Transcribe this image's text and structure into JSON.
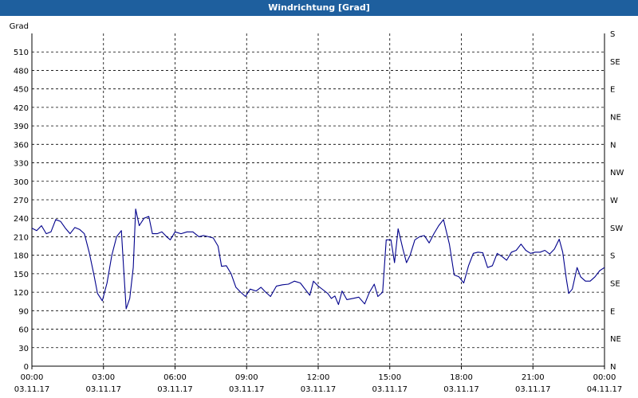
{
  "window": {
    "title": "Windrichtung [Grad]",
    "title_bar_color": "#1e5f9e"
  },
  "chart_data": {
    "type": "line",
    "title": "Windrichtung [Grad]",
    "ylabel": "Grad",
    "xlabel": "",
    "ylim": [
      0,
      540
    ],
    "y_ticks": [
      0,
      30,
      60,
      90,
      120,
      150,
      180,
      210,
      240,
      270,
      300,
      330,
      360,
      390,
      420,
      450,
      480,
      510
    ],
    "right_axis_labels": [
      {
        "value": 0,
        "label": "N"
      },
      {
        "value": 45,
        "label": "NE"
      },
      {
        "value": 90,
        "label": "E"
      },
      {
        "value": 135,
        "label": "SE"
      },
      {
        "value": 180,
        "label": "S"
      },
      {
        "value": 225,
        "label": "SW"
      },
      {
        "value": 270,
        "label": "W"
      },
      {
        "value": 315,
        "label": "NW"
      },
      {
        "value": 360,
        "label": "N"
      },
      {
        "value": 405,
        "label": "NE"
      },
      {
        "value": 450,
        "label": "E"
      },
      {
        "value": 495,
        "label": "SE"
      },
      {
        "value": 540,
        "label": "S"
      }
    ],
    "x_range_hours": [
      0,
      24
    ],
    "x_ticks": [
      {
        "hour": 0,
        "time": "00:00",
        "date": "03.11.17"
      },
      {
        "hour": 3,
        "time": "03:00",
        "date": "03.11.17"
      },
      {
        "hour": 6,
        "time": "06:00",
        "date": "03.11.17"
      },
      {
        "hour": 9,
        "time": "09:00",
        "date": "03.11.17"
      },
      {
        "hour": 12,
        "time": "12:00",
        "date": "03.11.17"
      },
      {
        "hour": 15,
        "time": "15:00",
        "date": "03.11.17"
      },
      {
        "hour": 18,
        "time": "18:00",
        "date": "03.11.17"
      },
      {
        "hour": 21,
        "time": "21:00",
        "date": "03.11.17"
      },
      {
        "hour": 24,
        "time": "00:00",
        "date": "04.11.17"
      }
    ],
    "grid": true,
    "line_color": "#00008b",
    "series": [
      {
        "points": [
          [
            0.0,
            224
          ],
          [
            0.2,
            220
          ],
          [
            0.4,
            228
          ],
          [
            0.6,
            215
          ],
          [
            0.8,
            218
          ],
          [
            1.0,
            238
          ],
          [
            1.2,
            235
          ],
          [
            1.4,
            224
          ],
          [
            1.6,
            215
          ],
          [
            1.8,
            225
          ],
          [
            2.0,
            222
          ],
          [
            2.2,
            215
          ],
          [
            2.4,
            185
          ],
          [
            2.6,
            148
          ],
          [
            2.75,
            118
          ],
          [
            2.95,
            106
          ],
          [
            3.15,
            135
          ],
          [
            3.35,
            180
          ],
          [
            3.55,
            210
          ],
          [
            3.75,
            220
          ],
          [
            3.85,
            155
          ],
          [
            3.95,
            93
          ],
          [
            4.1,
            110
          ],
          [
            4.25,
            160
          ],
          [
            4.35,
            255
          ],
          [
            4.5,
            228
          ],
          [
            4.7,
            240
          ],
          [
            4.9,
            243
          ],
          [
            5.05,
            215
          ],
          [
            5.25,
            215
          ],
          [
            5.45,
            218
          ],
          [
            5.65,
            210
          ],
          [
            5.8,
            205
          ],
          [
            6.0,
            218
          ],
          [
            6.25,
            215
          ],
          [
            6.5,
            218
          ],
          [
            6.75,
            218
          ],
          [
            7.0,
            210
          ],
          [
            7.2,
            212
          ],
          [
            7.4,
            210
          ],
          [
            7.6,
            208
          ],
          [
            7.8,
            195
          ],
          [
            7.95,
            162
          ],
          [
            8.15,
            163
          ],
          [
            8.35,
            150
          ],
          [
            8.55,
            128
          ],
          [
            8.75,
            120
          ],
          [
            8.95,
            113
          ],
          [
            9.15,
            125
          ],
          [
            9.4,
            122
          ],
          [
            9.6,
            128
          ],
          [
            9.8,
            120
          ],
          [
            10.0,
            113
          ],
          [
            10.25,
            130
          ],
          [
            10.5,
            132
          ],
          [
            10.75,
            133
          ],
          [
            11.0,
            138
          ],
          [
            11.25,
            135
          ],
          [
            11.45,
            125
          ],
          [
            11.65,
            115
          ],
          [
            11.8,
            138
          ],
          [
            12.0,
            130
          ],
          [
            12.2,
            124
          ],
          [
            12.4,
            118
          ],
          [
            12.55,
            110
          ],
          [
            12.7,
            114
          ],
          [
            12.85,
            100
          ],
          [
            13.0,
            122
          ],
          [
            13.2,
            108
          ],
          [
            13.45,
            110
          ],
          [
            13.7,
            112
          ],
          [
            13.95,
            101
          ],
          [
            14.15,
            120
          ],
          [
            14.35,
            133
          ],
          [
            14.5,
            113
          ],
          [
            14.7,
            120
          ],
          [
            14.85,
            205
          ],
          [
            15.05,
            205
          ],
          [
            15.2,
            168
          ],
          [
            15.35,
            223
          ],
          [
            15.55,
            190
          ],
          [
            15.7,
            168
          ],
          [
            15.85,
            180
          ],
          [
            16.05,
            205
          ],
          [
            16.25,
            210
          ],
          [
            16.45,
            212
          ],
          [
            16.65,
            200
          ],
          [
            16.85,
            215
          ],
          [
            17.05,
            228
          ],
          [
            17.25,
            238
          ],
          [
            17.5,
            198
          ],
          [
            17.7,
            148
          ],
          [
            17.9,
            145
          ],
          [
            18.1,
            135
          ],
          [
            18.3,
            163
          ],
          [
            18.5,
            183
          ],
          [
            18.7,
            185
          ],
          [
            18.9,
            184
          ],
          [
            19.1,
            160
          ],
          [
            19.3,
            163
          ],
          [
            19.5,
            183
          ],
          [
            19.7,
            178
          ],
          [
            19.9,
            172
          ],
          [
            20.1,
            185
          ],
          [
            20.3,
            188
          ],
          [
            20.5,
            198
          ],
          [
            20.7,
            188
          ],
          [
            20.9,
            183
          ],
          [
            21.1,
            185
          ],
          [
            21.3,
            185
          ],
          [
            21.5,
            188
          ],
          [
            21.7,
            182
          ],
          [
            21.9,
            190
          ],
          [
            22.1,
            206
          ],
          [
            22.25,
            185
          ],
          [
            22.4,
            142
          ],
          [
            22.5,
            118
          ],
          [
            22.65,
            125
          ],
          [
            22.85,
            160
          ],
          [
            23.0,
            145
          ],
          [
            23.2,
            138
          ],
          [
            23.4,
            138
          ],
          [
            23.6,
            145
          ],
          [
            23.8,
            155
          ],
          [
            24.0,
            160
          ]
        ]
      }
    ]
  }
}
